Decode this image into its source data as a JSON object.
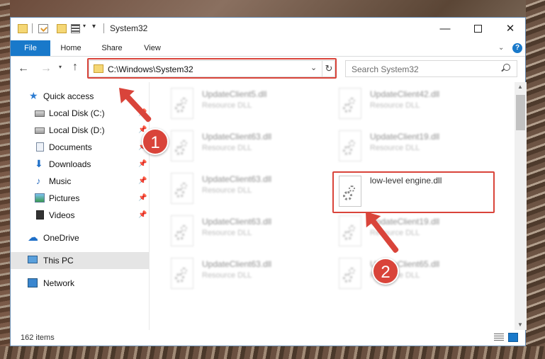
{
  "window": {
    "title": "System32",
    "min_glyph": "—",
    "close_glyph": "✕"
  },
  "ribbon": {
    "tabs": [
      {
        "label": "File"
      },
      {
        "label": "Home"
      },
      {
        "label": "Share"
      },
      {
        "label": "View"
      }
    ],
    "help_glyph": "?"
  },
  "navigation": {
    "back_glyph": "←",
    "forward_glyph": "→",
    "recent_glyph": "⌄",
    "up_glyph": "↑",
    "address": "C:\\Windows\\System32",
    "address_dropdown_glyph": "⌄",
    "refresh_glyph": "↻",
    "search_placeholder": "Search System32"
  },
  "sidebar": {
    "items": [
      {
        "label": "Quick access",
        "icon": "star-icon",
        "glyph": "★"
      },
      {
        "label": "Local Disk (C:)",
        "icon": "disk-icon",
        "pinned": true
      },
      {
        "label": "Local Disk (D:)",
        "icon": "disk-icon",
        "pinned": true
      },
      {
        "label": "Documents",
        "icon": "documents-icon",
        "pinned": true
      },
      {
        "label": "Downloads",
        "icon": "downloads-icon",
        "glyph": "⬇",
        "pinned": true
      },
      {
        "label": "Music",
        "icon": "music-icon",
        "glyph": "♪",
        "pinned": true
      },
      {
        "label": "Pictures",
        "icon": "pictures-icon",
        "pinned": true
      },
      {
        "label": "Videos",
        "icon": "videos-icon",
        "pinned": true
      },
      {
        "label": "OneDrive",
        "icon": "cloud-icon",
        "glyph": "☁"
      },
      {
        "label": "This PC",
        "icon": "computer-icon",
        "selected": true
      },
      {
        "label": "Network",
        "icon": "network-icon"
      }
    ],
    "pin_glyph": "📌"
  },
  "files": [
    {
      "name": "UpdateClient5.dll",
      "type": "Resource DLL",
      "blurred": true
    },
    {
      "name": "UpdateClient42.dll",
      "type": "Resource DLL",
      "blurred": true
    },
    {
      "name": "UpdateClient63.dll",
      "type": "Resource DLL",
      "blurred": true
    },
    {
      "name": "UpdateClient19.dll",
      "type": "Resource DLL",
      "blurred": true
    },
    {
      "name": "UpdateClient63.dll",
      "type": "Resource DLL",
      "blurred": true
    },
    {
      "name": "low-level engine.dll",
      "type": "",
      "blurred": false
    },
    {
      "name": "UpdateClient63.dll",
      "type": "Resource DLL",
      "blurred": true
    },
    {
      "name": "UpdateClient19.dll",
      "type": "Resource DLL",
      "blurred": true
    },
    {
      "name": "UpdateClient63.dll",
      "type": "Resource DLL",
      "blurred": true
    },
    {
      "name": "UpdateClient65.dll",
      "type": "Resource DLL",
      "blurred": true
    }
  ],
  "status": {
    "item_count": "162 items"
  },
  "callouts": [
    {
      "number": "1"
    },
    {
      "number": "2"
    }
  ],
  "colors": {
    "accent": "#1979ca",
    "callout_red": "#d9443a",
    "selection": "#cce8ff"
  }
}
